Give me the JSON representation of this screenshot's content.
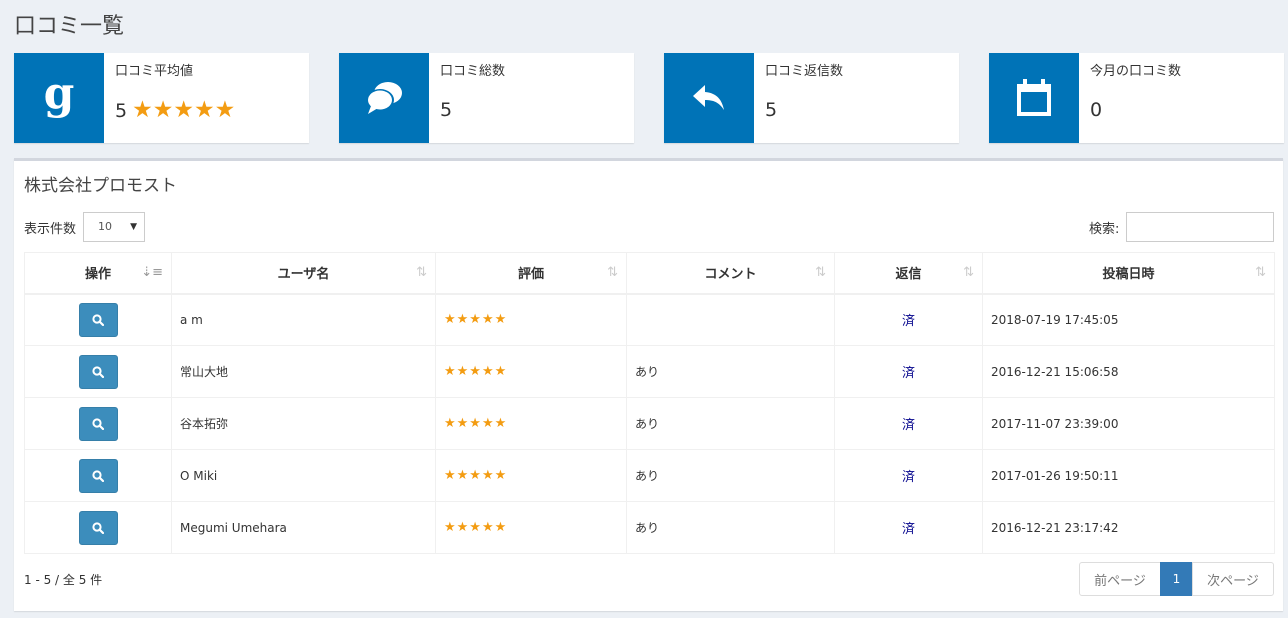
{
  "page": {
    "title": "口コミ一覧"
  },
  "stats": [
    {
      "label": "口コミ平均値",
      "value": "5",
      "stars": "★★★★★",
      "icon": "google-icon"
    },
    {
      "label": "口コミ総数",
      "value": "5",
      "icon": "comments-icon"
    },
    {
      "label": "口コミ返信数",
      "value": "5",
      "icon": "reply-icon"
    },
    {
      "label": "今月の口コミ数",
      "value": "0",
      "icon": "calendar-icon"
    }
  ],
  "google_letter": "g",
  "box": {
    "title": "株式会社プロモスト"
  },
  "controls": {
    "length_label": "表示件数",
    "length_value": "10",
    "search_label": "検索:",
    "search_value": ""
  },
  "table": {
    "columns": [
      "操作",
      "ユーザ名",
      "評価",
      "コメント",
      "返信",
      "投稿日時"
    ],
    "rows": [
      {
        "user": "a m",
        "rating_stars": "★★★★★",
        "rating": 5,
        "comment": "",
        "reply": "済",
        "date": "2018-07-19 17:45:05"
      },
      {
        "user": "常山大地",
        "rating_stars": "★★★★★",
        "rating": 5,
        "comment": "あり",
        "reply": "済",
        "date": "2016-12-21 15:06:58"
      },
      {
        "user": "谷本拓弥",
        "rating_stars": "★★★★★",
        "rating": 5,
        "comment": "あり",
        "reply": "済",
        "date": "2017-11-07 23:39:00"
      },
      {
        "user": "O Miki",
        "rating_stars": "★★★★★",
        "rating": 5,
        "comment": "あり",
        "reply": "済",
        "date": "2017-01-26 19:50:11"
      },
      {
        "user": "Megumi Umehara",
        "rating_stars": "★★★★★",
        "rating": 5,
        "comment": "あり",
        "reply": "済",
        "date": "2016-12-21 23:17:42"
      }
    ]
  },
  "footer": {
    "info": "1 - 5 / 全 5 件",
    "prev_label": "前ページ",
    "current_page": "1",
    "next_label": "次ページ"
  },
  "colors": {
    "accent": "#0073b7",
    "star": "#f39c12",
    "button": "#3c8dbc",
    "pager_active": "#337ab7",
    "reply": "#00008b"
  }
}
